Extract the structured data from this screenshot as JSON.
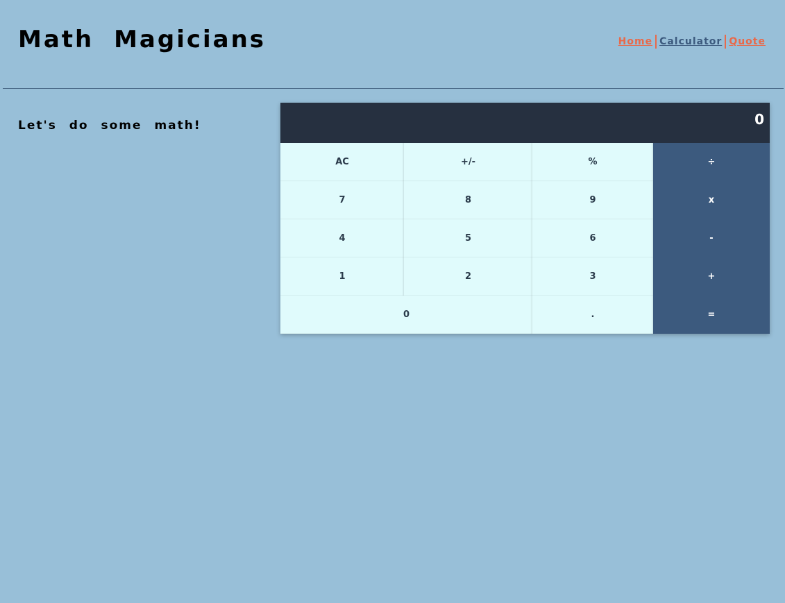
{
  "header": {
    "title": "Math Magicians",
    "nav": [
      {
        "label": "Home",
        "color": "#e8694a"
      },
      {
        "label": "Calculator",
        "color": "#3c5a7e"
      },
      {
        "label": "Quote",
        "color": "#e8694a"
      }
    ],
    "separator_color": "#e8694a"
  },
  "main": {
    "subtitle": "Let's do some math!"
  },
  "calculator": {
    "display": "0",
    "keys": [
      "AC",
      "+/-",
      "%",
      "÷",
      "7",
      "8",
      "9",
      "x",
      "4",
      "5",
      "6",
      "-",
      "1",
      "2",
      "3",
      "+",
      "0",
      ".",
      "="
    ]
  },
  "colors": {
    "background": "#98bfd8",
    "display_bg": "#263040",
    "key_bg": "#e0fbfc",
    "operator_bg": "#3c5a7e"
  }
}
